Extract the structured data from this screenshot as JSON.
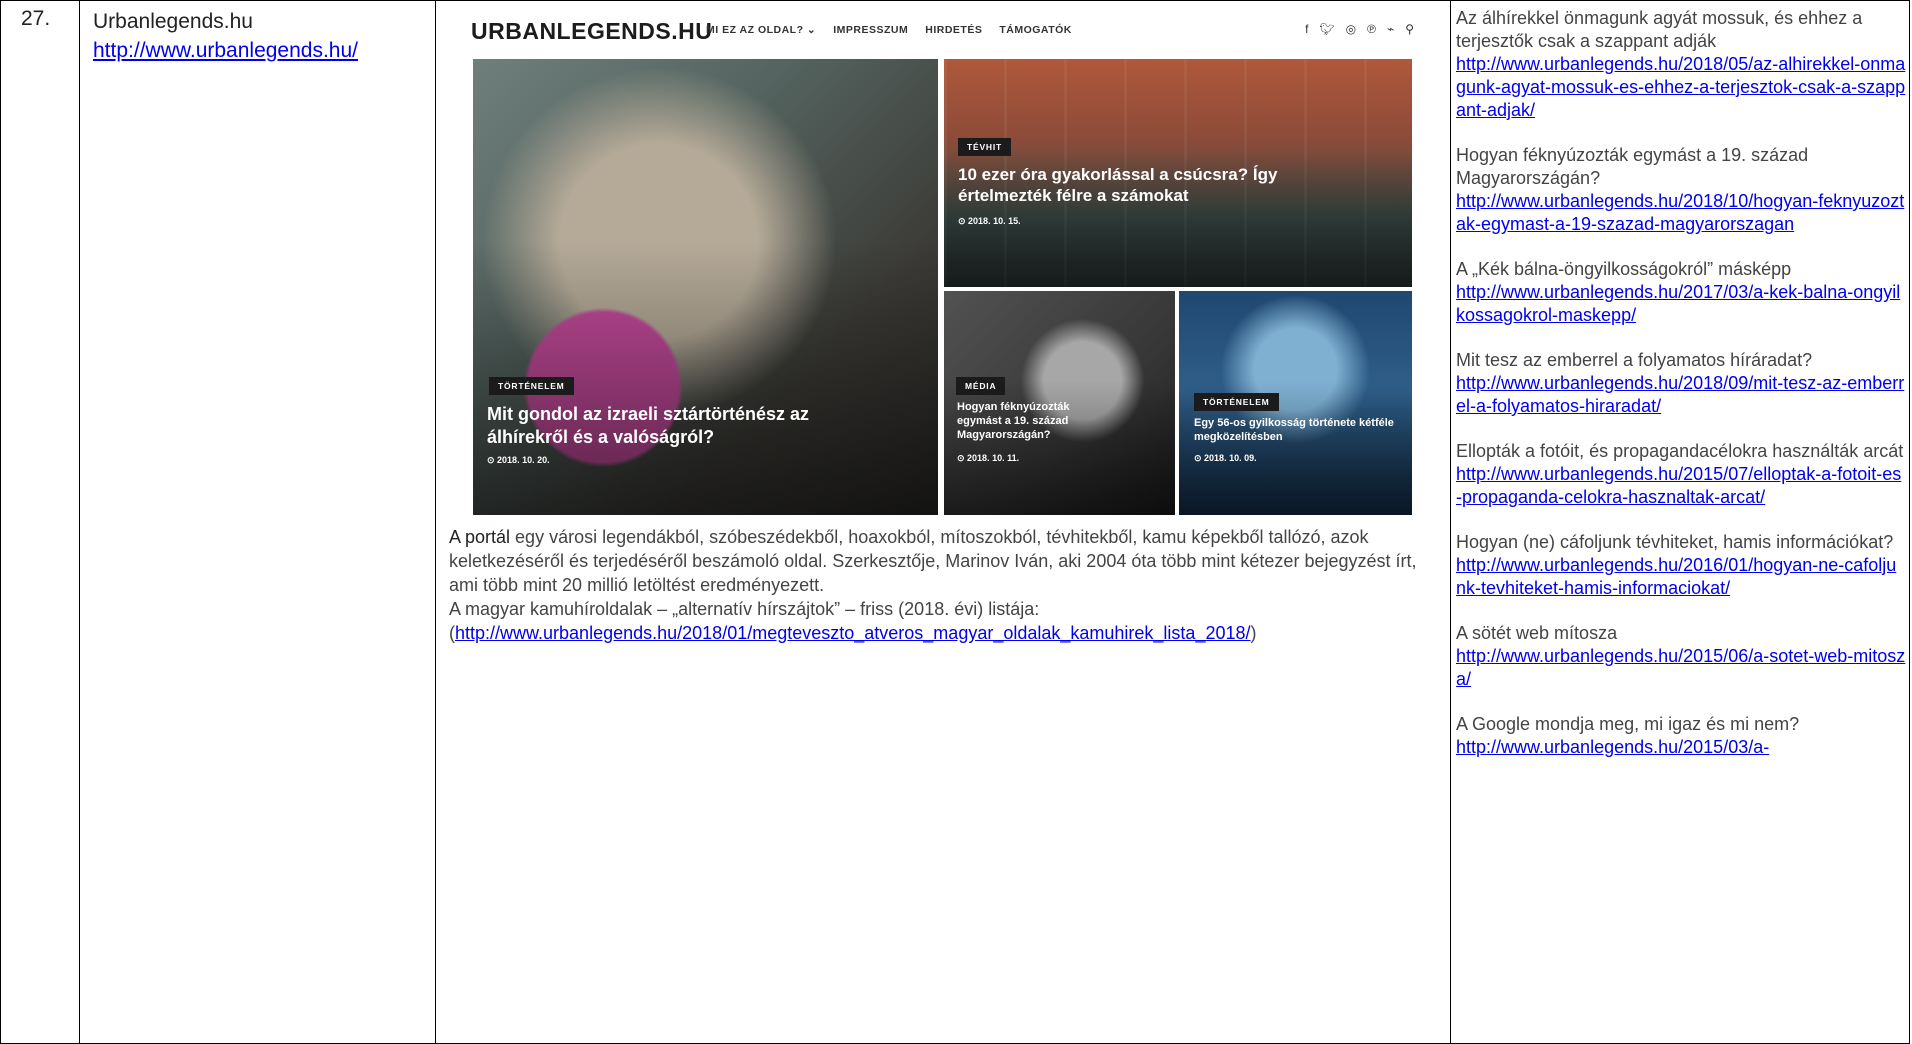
{
  "row": {
    "number": "27.",
    "site_name": "Urbanlegends.hu",
    "site_url": "http://www.urbanlegends.hu/"
  },
  "website": {
    "logo": "URBANLEGENDS.HU",
    "menu": [
      "MI EZ AZ OLDAL? ⌄",
      "IMPRESSZUM",
      "HIRDETÉS",
      "TÁMOGATÓK"
    ],
    "social_icons": [
      "facebook-icon",
      "twitter-icon",
      "instagram-icon",
      "pinterest-icon",
      "rss-icon",
      "search-icon"
    ],
    "tiles": [
      {
        "badge": "TÖRTÉNELEM",
        "title": "Mit gondol az izraeli sztártörténész az álhírekről és a valóságról?",
        "date": "⊙ 2018. 10. 20."
      },
      {
        "badge": "TÉVHIT",
        "title": "10 ezer óra gyakorlással a csúcsra? Így értelmezték félre a számokat",
        "date": "⊙ 2018. 10. 15."
      },
      {
        "badge": "MÉDIA",
        "title": "Hogyan féknyúzozták egymást a 19. század Magyarországán?",
        "date": "⊙ 2018. 10. 11."
      },
      {
        "badge": "TÖRTÉNELEM",
        "title": "Egy 56-os gyilkosság története kétféle megközelítésben",
        "date": "⊙ 2018. 10. 09."
      }
    ]
  },
  "description": {
    "highlight": "A portál",
    "text": " egy városi legendákból, szóbeszédekből, hoaxokból, mítoszokból, tévhitekből, kamu képekből tallózó, azok keletkezéséről és terjedéséről beszámoló oldal. Szerkesztője, Marinov Iván, aki 2004 óta több mint kétezer bejegyzést írt, ami több mint 20 millió letöltést eredményezett.",
    "list_line": "A magyar kamuhíroldalak – „alternatív hírszájtok” – friss (2018. évi) listája:",
    "list_open": "(",
    "list_url": "http://www.urbanlegends.hu/2018/01/megteveszto_atveros_magyar_oldalak_kamuhirek_lista_2018/",
    "list_close": ")"
  },
  "articles": [
    {
      "title": "Az álhírekkel önmagunk agyát mossuk, és ehhez a terjesztők csak a szappant adják",
      "url": "http://www.urbanlegends.hu/2018/05/az-alhirekkel-onmagunk-agyat-mossuk-es-ehhez-a-terjesztok-csak-a-szappant-adjak/"
    },
    {
      "title": "Hogyan féknyúzozták egymást a 19. század Magyarországán?",
      "url": "http://www.urbanlegends.hu/2018/10/hogyan-feknyuzoztak-egymast-a-19-szazad-magyarorszagan"
    },
    {
      "title": "A „Kék bálna-öngyilkosságokról” másképp",
      "url": "http://www.urbanlegends.hu/2017/03/a-kek-balna-ongyilkossagokrol-maskepp/"
    },
    {
      "title": "Mit tesz az emberrel a folyamatos híráradat?",
      "url": "http://www.urbanlegends.hu/2018/09/mit-tesz-az-emberrel-a-folyamatos-hiraradat/"
    },
    {
      "title": "Ellopták a fotóit, és propagandacélokra használták arcát",
      "url": "http://www.urbanlegends.hu/2015/07/elloptak-a-fotoit-es-propaganda-celokra-hasznaltak-arcat/"
    },
    {
      "title": "Hogyan (ne) cáfoljunk tévhiteket, hamis információkat?",
      "url": "http://www.urbanlegends.hu/2016/01/hogyan-ne-cafoljunk-tevhiteket-hamis-informaciokat/"
    },
    {
      "title": "A sötét web mítosza",
      "url": "http://www.urbanlegends.hu/2015/06/a-sotet-web-mitosza/"
    },
    {
      "title": "A Google mondja meg, mi igaz és mi nem?",
      "url": "http://www.urbanlegends.hu/2015/03/a-"
    }
  ]
}
